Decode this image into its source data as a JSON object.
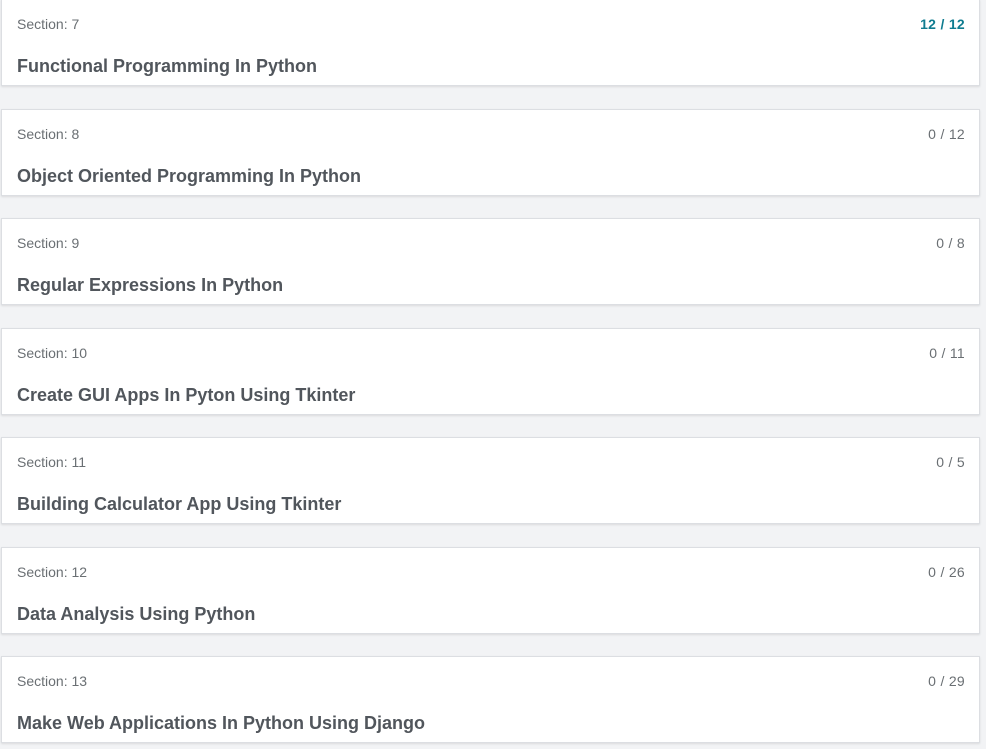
{
  "sections": [
    {
      "label": "Section: 7",
      "title": "Functional Programming In Python",
      "progress": "12 / 12",
      "complete": true
    },
    {
      "label": "Section: 8",
      "title": "Object Oriented Programming In Python",
      "progress": "0 / 12",
      "complete": false
    },
    {
      "label": "Section: 9",
      "title": "Regular Expressions In Python",
      "progress": "0 / 8",
      "complete": false
    },
    {
      "label": "Section: 10",
      "title": "Create GUI Apps In Pyton Using Tkinter",
      "progress": "0 / 11",
      "complete": false
    },
    {
      "label": "Section: 11",
      "title": "Building Calculator App Using Tkinter",
      "progress": "0 / 5",
      "complete": false
    },
    {
      "label": "Section: 12",
      "title": "Data Analysis Using Python",
      "progress": "0 / 26",
      "complete": false
    },
    {
      "label": "Section: 13",
      "title": "Make Web Applications In Python Using Django",
      "progress": "0 / 29",
      "complete": false
    }
  ],
  "colors": {
    "complete_progress": "#0f7c90",
    "text_muted": "#6a6f73",
    "title_text": "#51565c"
  }
}
